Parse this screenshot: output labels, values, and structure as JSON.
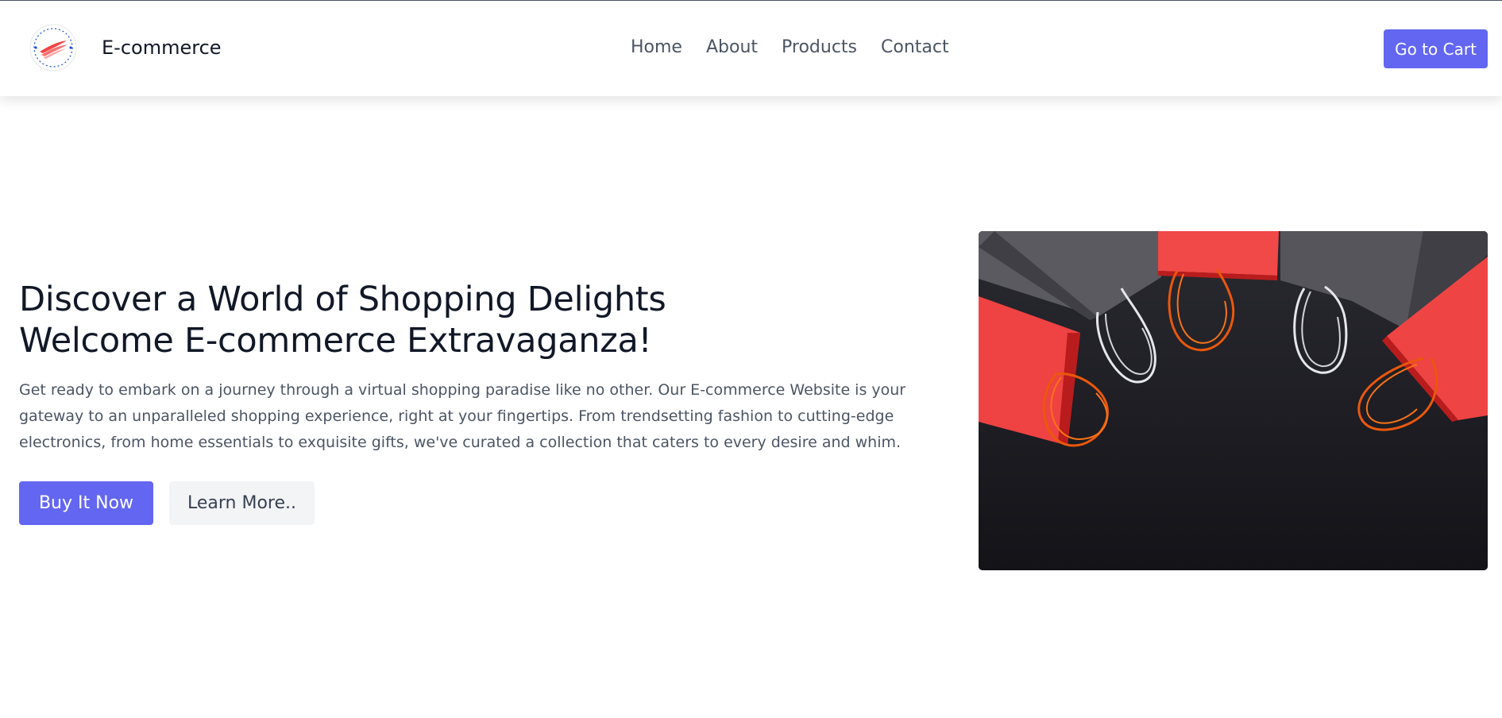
{
  "brand": {
    "name": "E-commerce",
    "logo_icon": "ecommerce-logo-icon",
    "logo_text": "E-commerce"
  },
  "nav": {
    "items": [
      {
        "label": "Home"
      },
      {
        "label": "About"
      },
      {
        "label": "Products"
      },
      {
        "label": "Contact"
      }
    ]
  },
  "header": {
    "cart_label": "Go to Cart"
  },
  "hero": {
    "title_line1": "Discover a World of Shopping Delights",
    "title_line2": "Welcome E-commerce Extravaganza!",
    "desc_line1": "Get ready to embark on a journey through a virtual shopping paradise like no other. Our E-commerce Website is your",
    "desc_line2": "gateway to an unparalleled shopping experience, right at your fingertips. From trendsetting fashion to cutting-edge",
    "desc_line3": "electronics, from home essentials to exquisite gifts, we've curated a collection that caters to every desire and whim.",
    "primary_label": "Buy It Now",
    "secondary_label": "Learn More..",
    "image_icon": "shopping-bags-image"
  },
  "colors": {
    "accent": "#6366f1",
    "heading": "#111827",
    "body_text": "#4b5563",
    "secondary_button": "#f3f4f6",
    "bag_red": "#ef4444",
    "bag_gray": "#52525b"
  }
}
